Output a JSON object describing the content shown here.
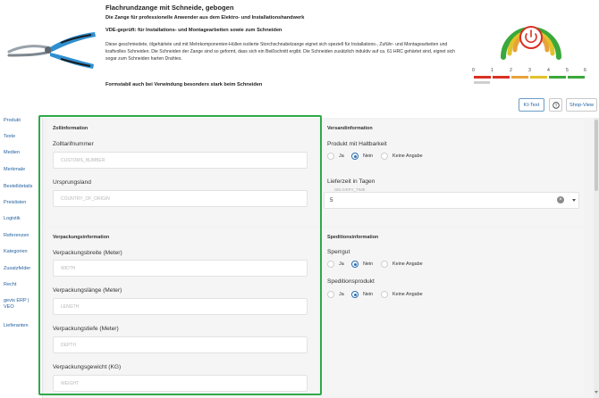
{
  "header": {
    "title": "Flachrundzange mit Schneide, gebogen",
    "subtitle": "Die Zange für professionelle Anwender aus dem Elektro- und Installationshandwerk",
    "subtitle2": "VDE-geprüft: für Installations- und Montagearbeiten sowie zum Schneiden",
    "description": "Diese geschmiedete, ölgehärtete und mit Mehrkomponenten-Hüllen isolierte Storchschnabelzange eignet sich speziell für Installations-, Zuführ- und Montagearbeiten und kraftvolles Schneiden. Die Schneiden der Zange sind so geformt, dass sich ein Beißschnitt ergibt. Die Schneiden zusätzlich induktiv auf ca. 61 HRC gehärtet sind, eignet sich sogar zum Schneiden harten Drahtes.",
    "note": "Formstabil auch bei Verwindung besonders stark beim Schneiden",
    "scale_labels": [
      "0",
      "1",
      "2",
      "3",
      "4",
      "5",
      "6"
    ],
    "buttons": {
      "ki": "KI-Text",
      "info": "?",
      "shop": "Shop-View"
    },
    "colors": {
      "red": "#d93025",
      "orange": "#e8a23a",
      "yellow": "#e3c22a",
      "green": "#3aa83a",
      "power": "#d93025"
    }
  },
  "sidebar": {
    "items": [
      "Produkt",
      "Texte",
      "Medien",
      "Merkmale",
      "Bestelldetails",
      "Preislisten",
      "Logistik",
      "Referenzen",
      "Kategorien",
      "Zusatzfelder",
      "Recht",
      "gevis ERP | VEO",
      "Lieferanten"
    ]
  },
  "zoll": {
    "title": "Zollinformation",
    "tariff_label": "Zolltarifnummer",
    "tariff_placeholder": "CUSTOMS_NUMBER",
    "origin_label": "Ursprungsland",
    "origin_placeholder": "COUNTRY_OF_ORIGIN"
  },
  "verpackung": {
    "title": "Verpackungsinformation",
    "fields": [
      {
        "label": "Verpackungsbreite (Meter)",
        "placeholder": "WIDTH"
      },
      {
        "label": "Verpackungslänge (Meter)",
        "placeholder": "LENGTH"
      },
      {
        "label": "Verpackungstiefe (Meter)",
        "placeholder": "DEPTH"
      },
      {
        "label": "Verpackungsgewicht (KG)",
        "placeholder": "WEIGHT"
      }
    ]
  },
  "versand": {
    "title": "Versandinformation",
    "haltbarkeit_label": "Produkt mit Haltbarkeit",
    "options": [
      "Ja",
      "Nein",
      "Keine Angabe"
    ],
    "lieferzeit_label": "Lieferzeit in Tagen",
    "lieferzeit_floating": "DELIVERY_TIME",
    "lieferzeit_value": "5"
  },
  "spedition": {
    "title": "Speditionsinformation",
    "sperrgut_label": "Sperrgut",
    "produkt_label": "Speditionsprodukt",
    "options": [
      "Ja",
      "Nein",
      "Keine Angabe"
    ]
  }
}
